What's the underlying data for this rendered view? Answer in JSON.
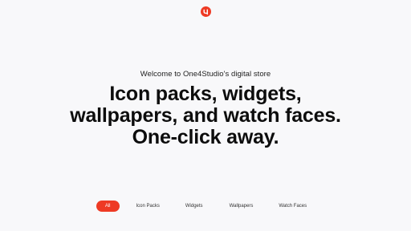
{
  "brand": {
    "logo_icon": "one4studio-logo-icon",
    "accent_color": "#ee3a24"
  },
  "hero": {
    "subtitle": "Welcome to One4Studio's digital store",
    "headline_line1": "Icon packs, widgets,",
    "headline_line2": "wallpapers, and watch faces.",
    "headline_line3": "One-click away."
  },
  "tabs": [
    {
      "label": "All",
      "active": true
    },
    {
      "label": "Icon Packs",
      "active": false
    },
    {
      "label": "Widgets",
      "active": false
    },
    {
      "label": "Wallpapers",
      "active": false
    },
    {
      "label": "Watch Faces",
      "active": false
    }
  ]
}
